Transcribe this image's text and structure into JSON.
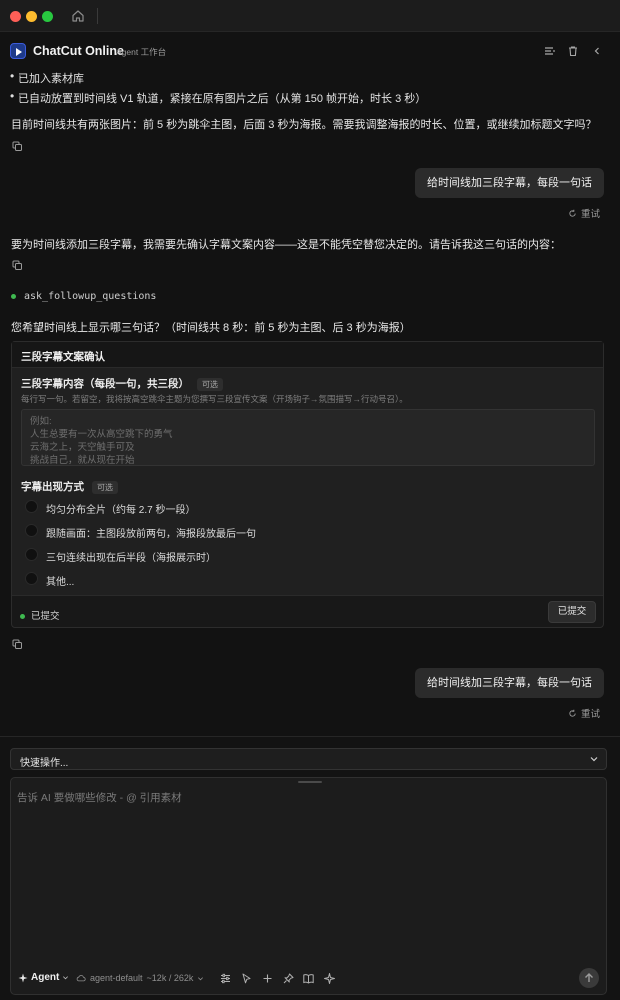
{
  "header": {
    "app_title": "ChatCut Online",
    "subtitle": "Agent 工作台"
  },
  "chat": {
    "bullets": [
      "已加入素材库",
      "已自动放置到时间线 V1 轨道，紧接在原有图片之后（从第 150 帧开始，时长 3 秒）"
    ],
    "assistant_msg_1": "目前时间线共有两张图片：前 5 秒为跳伞主图，后面 3 秒为海报。需要我调整海报的时长、位置，或继续加标题文字吗？",
    "user_msg_1": "给时间线加三段字幕，每段一句话",
    "retry_label": "重试",
    "assistant_msg_2": "要为时间线添加三段字幕，我需要先确认字幕文案内容——这是不能凭空替您决定的。请告诉我这三句话的内容：",
    "tool_call_name": "ask_followup_questions",
    "question_intro": "您希望时间线上显示哪三句话？（时间线共 8 秒：前 5 秒为主图、后 3 秒为海报）",
    "user_msg_2": "给时间线加三段字幕，每段一句话"
  },
  "question_card": {
    "title": "三段字幕文案确认",
    "q1_label": "三段字幕内容（每段一句，共三段）",
    "optional_tag": "可选",
    "q1_hint": "每行写一句。若留空，我将按高空跳伞主题为您撰写三段宣传文案（开场钩子→氛围描写→行动号召）。",
    "q1_placeholder": "例如:\n人生总要有一次从高空跳下的勇气\n云海之上，天空触手可及\n挑战自己，就从现在开始",
    "q2_label": "字幕出现方式",
    "q2_options": [
      "均匀分布全片（约每 2.7 秒一段）",
      "跟随画面：主图段放前两句，海报段放最后一句",
      "三句连续出现在后半段（海报展示时）",
      "其他..."
    ],
    "status": "已提交",
    "submit_button": "已提交"
  },
  "bottom": {
    "quick_actions": "快速操作...",
    "composer_placeholder": "告诉 AI 要做哪些修改 - @ 引用素材",
    "agent_mode": "Agent",
    "model_label": "agent-default",
    "context_usage": "~12k / 262k"
  },
  "colors": {
    "background": "#121212",
    "bubble": "#2b2b2b",
    "accent_green": "#3fb950",
    "traffic_red": "#fe5f57",
    "traffic_yellow": "#febc2e",
    "traffic_green": "#28c840"
  }
}
